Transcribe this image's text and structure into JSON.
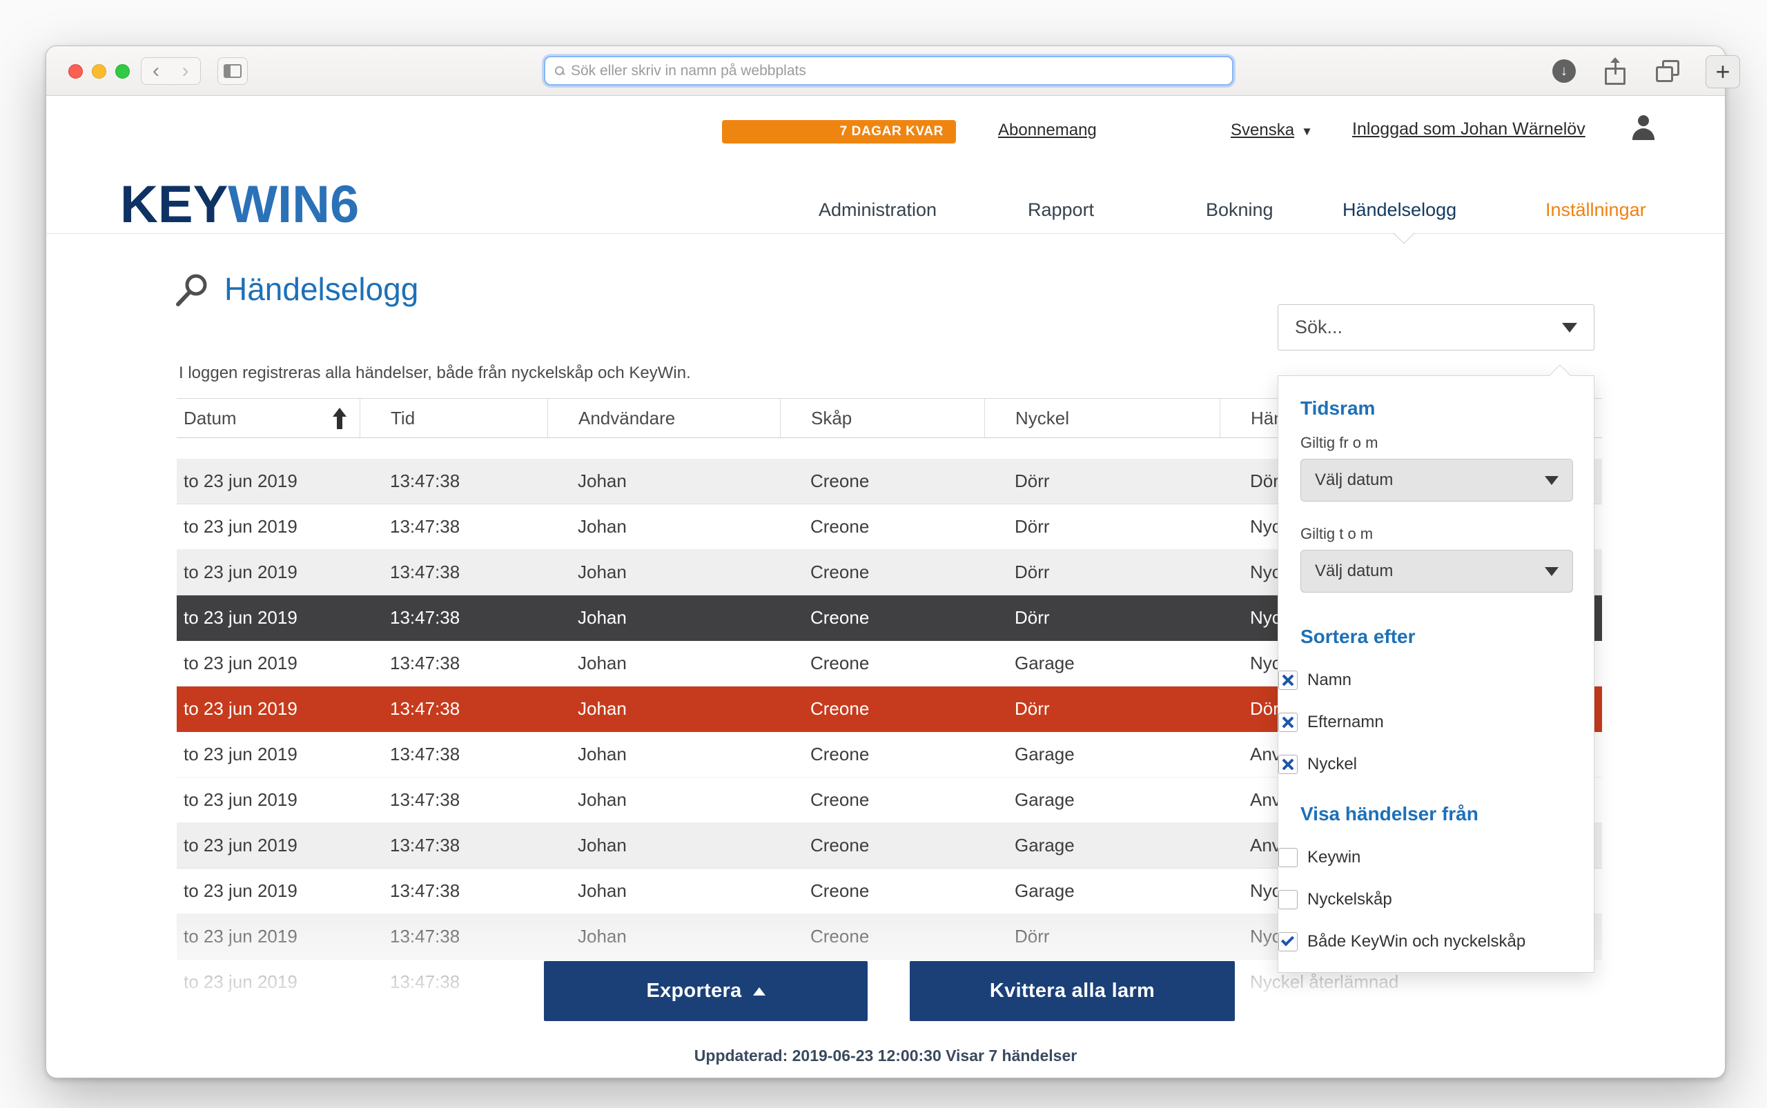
{
  "browser": {
    "url_placeholder": "Sök eller skriv in namn på webbplats"
  },
  "icons": {
    "back": "‹",
    "forward": "›",
    "caret_down": "▼",
    "download_arrow": "↓",
    "plus": "+"
  },
  "topbar": {
    "trial_badge": "7 DAGAR KVAR",
    "subscription_link": "Abonnemang",
    "language": "Svenska",
    "logged_in": "Inloggad som Johan Wärnelöv"
  },
  "logo": {
    "part1": "KEY",
    "part2": "WIN",
    "part3": "6"
  },
  "nav": {
    "items": [
      {
        "label": "Administration",
        "active": false
      },
      {
        "label": "Rapport",
        "active": false
      },
      {
        "label": "Bokning",
        "active": false
      },
      {
        "label": "Händelselogg",
        "active": true
      },
      {
        "label": "Inställningar",
        "active": false,
        "highlight": true
      }
    ]
  },
  "page": {
    "title": "Händelselogg",
    "subtitle": "I loggen registreras alla händelser, både från nyckelskåp och KeyWin.",
    "search_dropdown_label": "Sök..."
  },
  "filter_panel": {
    "section_timeframe": "Tidsram",
    "valid_from_label": "Giltig fr o m",
    "valid_to_label": "Giltig t o m",
    "date_select_label": "Välj datum",
    "section_sort": "Sortera efter",
    "sort_options": [
      {
        "label": "Namn",
        "checked": true,
        "mark": "x"
      },
      {
        "label": "Efternamn",
        "checked": true,
        "mark": "x"
      },
      {
        "label": "Nyckel",
        "checked": true,
        "mark": "x"
      }
    ],
    "section_source": "Visa händelser från",
    "source_options": [
      {
        "label": "Keywin",
        "checked": false,
        "mark": "none"
      },
      {
        "label": "Nyckelskåp",
        "checked": false,
        "mark": "none"
      },
      {
        "label": "Både KeyWin och nyckelskåp",
        "checked": true,
        "mark": "check"
      }
    ]
  },
  "table": {
    "headers": [
      "Datum",
      "Tid",
      "Andvändare",
      "Skåp",
      "Nyckel",
      "Händelse"
    ],
    "sort_column": "Datum",
    "sort_direction": "asc",
    "rows": [
      {
        "datum": "to 23 jun 2019",
        "tid": "13:47:38",
        "anvandare": "Johan",
        "skap": "Creone",
        "nyckel": "Dörr",
        "handelse": "Dörr",
        "variant": "gray"
      },
      {
        "datum": "to 23 jun 2019",
        "tid": "13:47:38",
        "anvandare": "Johan",
        "skap": "Creone",
        "nyckel": "Dörr",
        "handelse": "Nyc",
        "variant": "white"
      },
      {
        "datum": "to 23 jun 2019",
        "tid": "13:47:38",
        "anvandare": "Johan",
        "skap": "Creone",
        "nyckel": "Dörr",
        "handelse": "Nyc",
        "variant": "gray"
      },
      {
        "datum": "to 23 jun 2019",
        "tid": "13:47:38",
        "anvandare": "Johan",
        "skap": "Creone",
        "nyckel": "Dörr",
        "handelse": "Nyc",
        "variant": "dark"
      },
      {
        "datum": "to 23 jun 2019",
        "tid": "13:47:38",
        "anvandare": "Johan",
        "skap": "Creone",
        "nyckel": "Garage",
        "handelse": "Nyc",
        "variant": "white"
      },
      {
        "datum": "to 23 jun 2019",
        "tid": "13:47:38",
        "anvandare": "Johan",
        "skap": "Creone",
        "nyckel": "Dörr",
        "handelse": "Dörr",
        "variant": "red"
      },
      {
        "datum": "to 23 jun 2019",
        "tid": "13:47:38",
        "anvandare": "Johan",
        "skap": "Creone",
        "nyckel": "Garage",
        "handelse": "Anv",
        "variant": "white"
      },
      {
        "datum": "to 23 jun 2019",
        "tid": "13:47:38",
        "anvandare": "Johan",
        "skap": "Creone",
        "nyckel": "Garage",
        "handelse": "Anv",
        "variant": "white"
      },
      {
        "datum": "to 23 jun 2019",
        "tid": "13:47:38",
        "anvandare": "Johan",
        "skap": "Creone",
        "nyckel": "Garage",
        "handelse": "Anv",
        "variant": "gray"
      },
      {
        "datum": "to 23 jun 2019",
        "tid": "13:47:38",
        "anvandare": "Johan",
        "skap": "Creone",
        "nyckel": "Garage",
        "handelse": "Nyc",
        "variant": "white"
      },
      {
        "datum": "to 23 jun 2019",
        "tid": "13:47:38",
        "anvandare": "Johan",
        "skap": "Creone",
        "nyckel": "Dörr",
        "handelse": "Nyc",
        "variant": "gray"
      },
      {
        "datum": "to 23 jun 2019",
        "tid": "13:47:38",
        "anvandare": "",
        "skap": "",
        "nyckel": "",
        "handelse": "Nyckel återlämnad",
        "variant": "white"
      }
    ]
  },
  "actions": {
    "export_label": "Exportera",
    "ack_label": "Kvittera alla larm"
  },
  "footer": {
    "status": "Uppdaterad: 2019-06-23 12:00:30 Visar 7 händelser"
  },
  "colors": {
    "accent_orange": "#ef8511",
    "brand_navy": "#0e3263",
    "brand_blue": "#2a71b8",
    "heading_blue": "#1d70b7",
    "alarm_red": "#c63b1d",
    "row_dark": "#404042",
    "button_navy": "#1b4078"
  }
}
